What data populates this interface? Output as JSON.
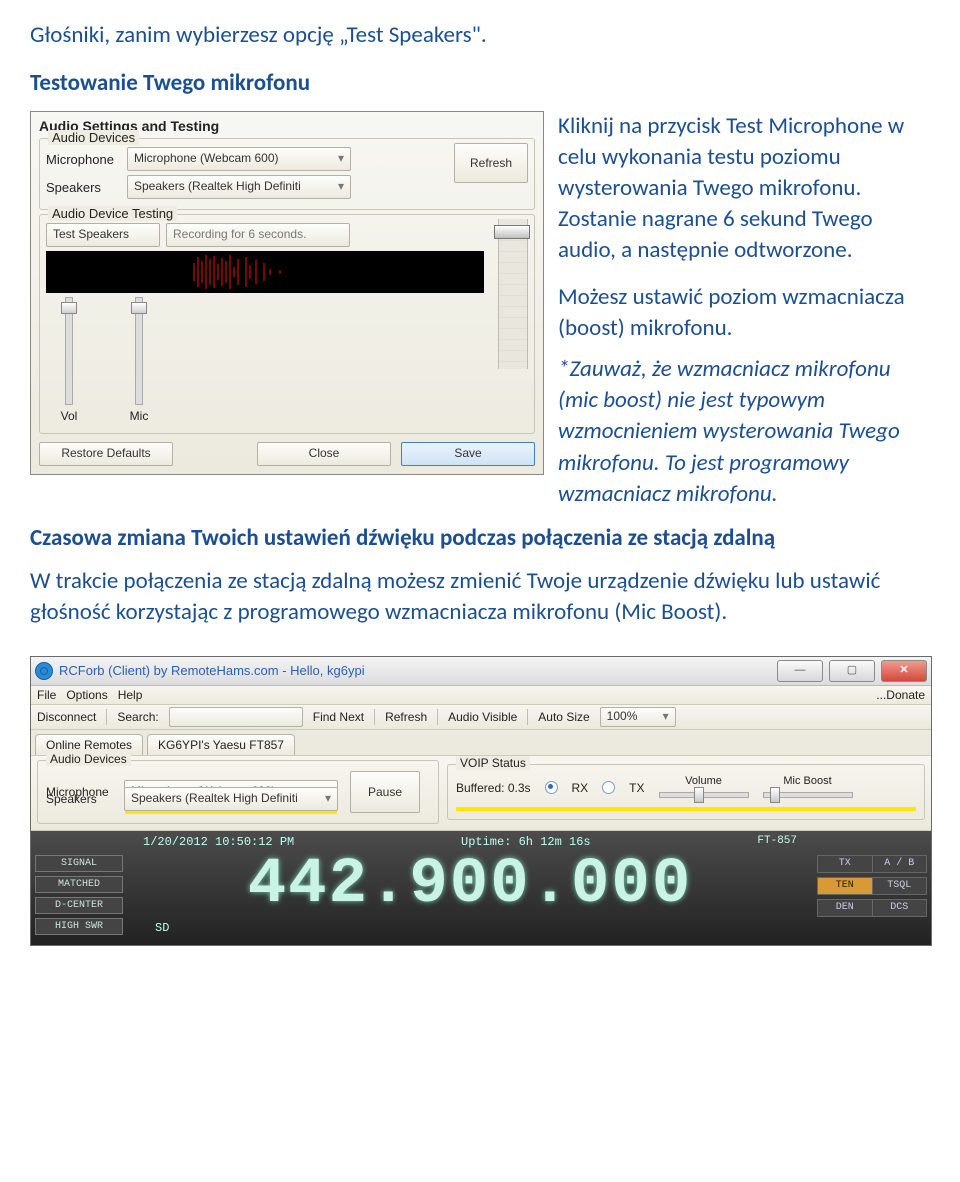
{
  "doc": {
    "line1": "Głośniki, zanim wybierzesz opcję „Test Speakers\".",
    "heading": "Testowanie Twego mikrofonu",
    "para1a": "Kliknij na przycisk Test Microphone w celu wykonania testu poziomu wysterowania Twego mikrofonu. Zostanie nagrane 6 sekund Twego audio, a następnie odtworzone.",
    "para1b": "Możesz ustawić poziom wzmacniacza (boost) mikrofonu.",
    "para_italic_continue": "*Zauważ, że wzmacniacz mikrofonu (mic boost) nie jest typowym wzmocnieniem wysterowania Twego mikrofonu. To jest  programowy wzmacniacz mikrofonu.",
    "heading2": "Czasowa zmiana Twoich ustawień dźwięku podczas połączenia ze stacją zdalną",
    "para2": "W trakcie połączenia ze stacją zdalną możesz zmienić Twoje urządzenie dźwięku lub ustawić głośność korzystając z programowego wzmacniacza mikrofonu (Mic Boost)."
  },
  "panel": {
    "title": "Audio Settings and Testing",
    "devices_legend": "Audio Devices",
    "mic_label": "Microphone",
    "mic_value": "Microphone (Webcam 600)",
    "spk_label": "Speakers",
    "spk_value": "Speakers (Realtek High Definiti",
    "refresh": "Refresh",
    "testing_legend": "Audio Device Testing",
    "test_speakers": "Test Speakers",
    "recording": "Recording for 6 seconds.",
    "vol": "Vol",
    "mic": "Mic",
    "restore": "Restore Defaults",
    "close": "Close",
    "save": "Save"
  },
  "app": {
    "title": "RCForb (Client) by RemoteHams.com - Hello, kg6ypi",
    "menu": {
      "file": "File",
      "options": "Options",
      "help": "Help",
      "donate": "...Donate"
    },
    "toolbar": {
      "disconnect": "Disconnect",
      "search": "Search:",
      "find_next": "Find Next",
      "refresh": "Refresh",
      "audio_visible": "Audio Visible",
      "auto_size": "Auto Size",
      "zoom": "100%"
    },
    "tabs": {
      "online": "Online Remotes",
      "station": "KG6YPI's Yaesu FT857"
    },
    "audio": {
      "devices_legend": "Audio Devices",
      "mic_label": "Microphone",
      "mic_value": "Microphone (Webcam 600)",
      "spk_label": "Speakers",
      "spk_value": "Speakers (Realtek High Definiti",
      "pause": "Pause",
      "voip_legend": "VOIP Status",
      "buffered": "Buffered: 0.3s",
      "rx": "RX",
      "tx": "TX",
      "volume": "Volume",
      "micboost": "Mic Boost"
    },
    "radio": {
      "date": "1/20/2012 10:50:12 PM",
      "uptime": "Uptime: 6h 12m 16s",
      "model": "FT-857",
      "signal": "SIGNAL",
      "matched": "MATCHED",
      "dcenter": "D-CENTER",
      "highswr": "HIGH SWR",
      "sd": "SD",
      "freq": "442.900.000",
      "tx": "TX",
      "ab": "A / B",
      "ten": "TEN",
      "tsql": "TSQL",
      "den": "DEN",
      "dcs": "DCS"
    }
  }
}
